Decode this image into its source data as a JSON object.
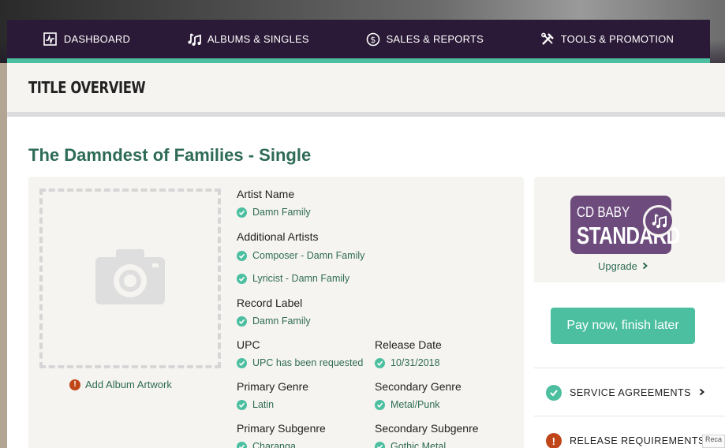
{
  "nav": {
    "items": [
      {
        "label": "DASHBOARD",
        "icon": "pulse-icon"
      },
      {
        "label": "ALBUMS & SINGLES",
        "icon": "music-notes-icon"
      },
      {
        "label": "SALES & REPORTS",
        "icon": "dollar-circle-icon"
      },
      {
        "label": "TOOLS & PROMOTION",
        "icon": "tools-icon"
      }
    ]
  },
  "page_title": "TITLE OVERVIEW",
  "release_title": "The Damndest of Families - Single",
  "artwork": {
    "add_label": "Add Album Artwork"
  },
  "fields": {
    "artist_name": {
      "label": "Artist Name",
      "value": "Damn Family"
    },
    "additional_artists": {
      "label": "Additional Artists",
      "values": [
        "Composer - Damn Family",
        "Lyricist - Damn Family"
      ]
    },
    "record_label": {
      "label": "Record Label",
      "value": "Damn Family"
    },
    "upc": {
      "label": "UPC",
      "value": "UPC has been requested"
    },
    "release_date": {
      "label": "Release Date",
      "value": "10/31/2018"
    },
    "primary_genre": {
      "label": "Primary Genre",
      "value": "Latin"
    },
    "secondary_genre": {
      "label": "Secondary Genre",
      "value": "Metal/Punk"
    },
    "primary_subgenre": {
      "label": "Primary Subgenre",
      "value": "Charanga"
    },
    "secondary_subgenre": {
      "label": "Secondary Subgenre",
      "value": "Gothic Metal"
    }
  },
  "plan": {
    "badge_line1": "CD BABY",
    "badge_line2": "STANDARD",
    "upgrade_label": "Upgrade"
  },
  "pay_button": "Pay now, finish later",
  "requirements": [
    {
      "label": "SERVICE AGREEMENTS",
      "status": "complete"
    },
    {
      "label": "RELEASE REQUIREMENTS",
      "status": "error"
    }
  ],
  "recaptcha": "Reca",
  "colors": {
    "accent": "#4cbfa0",
    "nav_bg": "#2b1a37",
    "title_green": "#2e6b56",
    "badge_purple": "#6d4c7d",
    "error": "#c0461a"
  }
}
